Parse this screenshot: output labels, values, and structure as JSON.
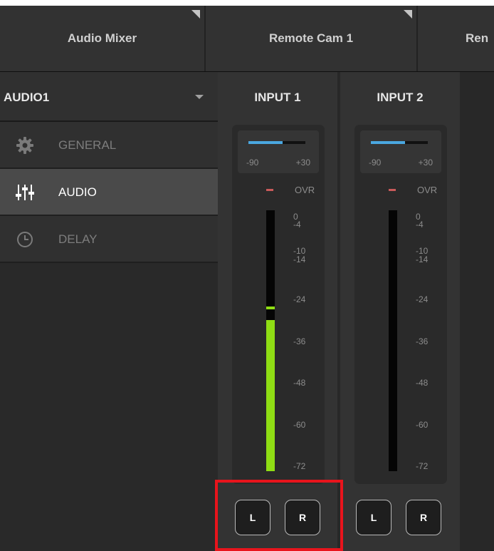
{
  "tabs": [
    {
      "label": "Audio Mixer"
    },
    {
      "label": "Remote Cam 1"
    },
    {
      "label": "Ren"
    }
  ],
  "sidebar": {
    "source_selected": "AUDIO1",
    "items": [
      {
        "label": "GENERAL",
        "icon": "gear-icon",
        "active": false
      },
      {
        "label": "AUDIO",
        "icon": "sliders-icon",
        "active": true
      },
      {
        "label": "DELAY",
        "icon": "clock-icon",
        "active": false
      }
    ]
  },
  "channels": [
    {
      "title": "INPUT 1",
      "volume": {
        "min_label": "-90",
        "max_label": "+30",
        "level_fraction": 0.6
      },
      "ovr_label": "OVR",
      "meter": {
        "level_fraction": 0.58,
        "peak_fraction": 0.62
      },
      "scale_ticks": [
        "0",
        "-4",
        "-10",
        "-14",
        "-24",
        "-36",
        "-48",
        "-60",
        "-72"
      ],
      "left_button": "L",
      "right_button": "R"
    },
    {
      "title": "INPUT 2",
      "volume": {
        "min_label": "-90",
        "max_label": "+30",
        "level_fraction": 0.6
      },
      "ovr_label": "OVR",
      "meter": {
        "level_fraction": 0.0,
        "peak_fraction": 0.0
      },
      "scale_ticks": [
        "0",
        "-4",
        "-10",
        "-14",
        "-24",
        "-36",
        "-48",
        "-60",
        "-72"
      ],
      "left_button": "L",
      "right_button": "R"
    }
  ],
  "colors": {
    "accent_blue": "#4aa7e0",
    "meter_green": "#8fdd14",
    "highlight_red": "#e8141c"
  }
}
